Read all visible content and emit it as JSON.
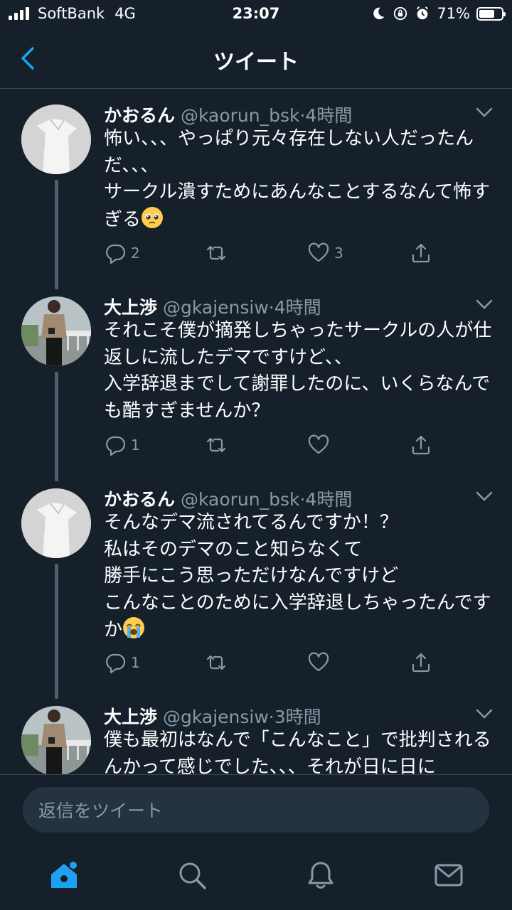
{
  "status_bar": {
    "carrier": "SoftBank",
    "network": "4G",
    "time": "23:07",
    "battery": "71%",
    "battery_level": 0.71
  },
  "header": {
    "title": "ツイート"
  },
  "tweets": [
    {
      "name": "かおるん",
      "handle": "@kaorun_bsk",
      "time": "4時間",
      "text": "怖い、、、やっぱり元々存在しない人だったんだ、、、\nサークル潰すためにあんなことするなんて怖すぎる",
      "emoji": "pleading-face",
      "replies": "2",
      "retweets": "",
      "likes": "3"
    },
    {
      "name": "大上渉",
      "handle": "@gkajensiw",
      "time": "4時間",
      "text": "それこそ僕が摘発しちゃったサークルの人が仕返しに流したデマですけど、、\n入学辞退までして謝罪したのに、いくらなんでも酷すぎませんか？",
      "emoji": "",
      "replies": "1",
      "retweets": "",
      "likes": ""
    },
    {
      "name": "かおるん",
      "handle": "@kaorun_bsk",
      "time": "4時間",
      "text": "そんなデマ流されてるんですか！？\n私はそのデマのこと知らなくて\n勝手にこう思っただけなんですけど\nこんなことのために入学辞退しちゃったんですか",
      "emoji": "loudly-crying-face",
      "replies": "1",
      "retweets": "",
      "likes": ""
    },
    {
      "name": "大上渉",
      "handle": "@gkajensiw",
      "time": "3時間",
      "text": "僕も最初はなんで「こんなこと」で批判されるんかって感じでした、、、それが日に日に",
      "emoji": "",
      "replies": "",
      "retweets": "",
      "likes": ""
    }
  ],
  "reply_bar": {
    "placeholder": "返信をツイート"
  },
  "tab_bar": {
    "tabs": [
      "home-icon",
      "search-icon",
      "notifications-icon",
      "messages-icon"
    ]
  },
  "colors": {
    "background": "#15202b",
    "accent": "#1da1f2",
    "secondary_text": "#8899a6",
    "divider": "#38444d"
  }
}
